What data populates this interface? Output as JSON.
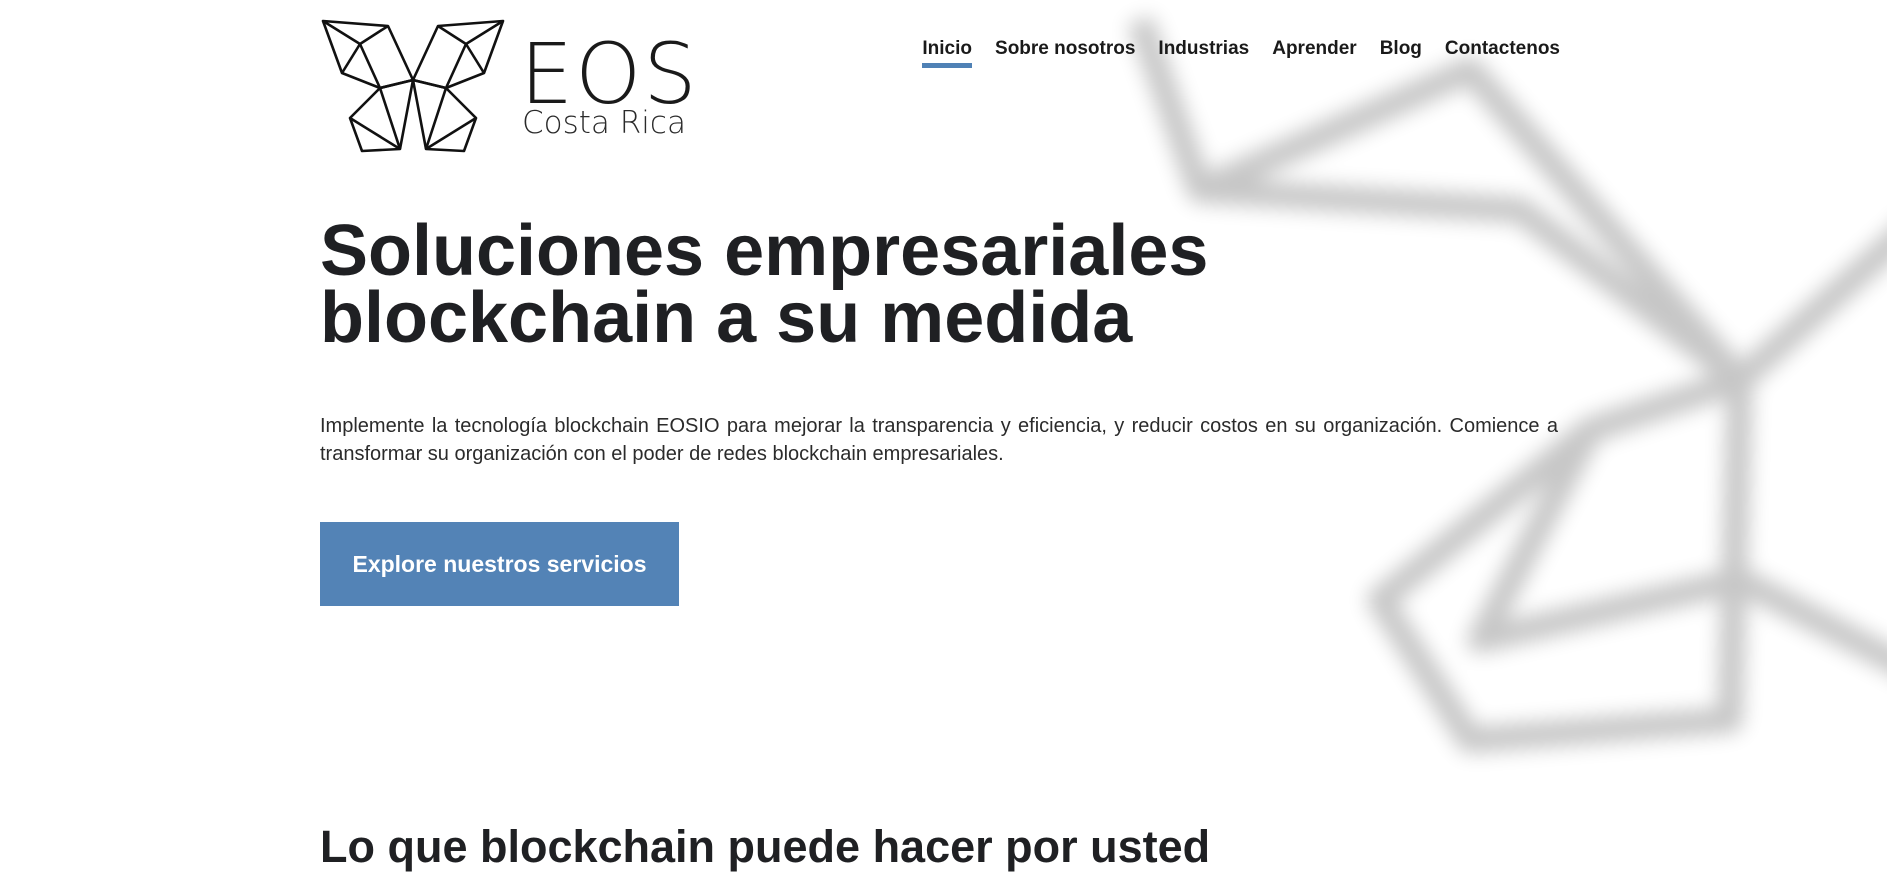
{
  "brand": {
    "logo_icon": "butterfly-logo-icon",
    "name": "EOS",
    "subtitle": "Costa Rica"
  },
  "nav": {
    "items": [
      {
        "label": "Inicio",
        "active": true
      },
      {
        "label": "Sobre nosotros",
        "active": false
      },
      {
        "label": "Industrias",
        "active": false
      },
      {
        "label": "Aprender",
        "active": false
      },
      {
        "label": "Blog",
        "active": false
      },
      {
        "label": "Contactenos",
        "active": false
      }
    ]
  },
  "hero": {
    "title_line1": "Soluciones empresariales",
    "title_line2": "blockchain a su medida",
    "description": "Implemente la tecnología blockchain EOSIO para mejorar la transparencia y eficiencia, y reducir costos en su organización. Comience a transformar su organización con el poder de redes blockchain empresariales.",
    "cta_label": "Explore nuestros servicios"
  },
  "section": {
    "title": "Lo que blockchain puede hacer por usted"
  },
  "colors": {
    "accent": "#5383b6",
    "text": "#1f2023",
    "background": "#ffffff"
  }
}
